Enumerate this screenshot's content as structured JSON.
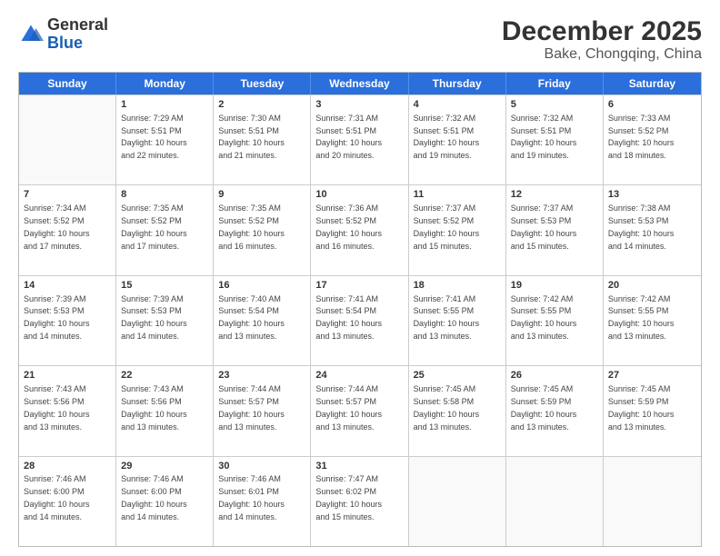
{
  "logo": {
    "general": "General",
    "blue": "Blue"
  },
  "title": "December 2025",
  "subtitle": "Bake, Chongqing, China",
  "weekdays": [
    "Sunday",
    "Monday",
    "Tuesday",
    "Wednesday",
    "Thursday",
    "Friday",
    "Saturday"
  ],
  "rows": [
    [
      {
        "day": "",
        "info": ""
      },
      {
        "day": "1",
        "info": "Sunrise: 7:29 AM\nSunset: 5:51 PM\nDaylight: 10 hours\nand 22 minutes."
      },
      {
        "day": "2",
        "info": "Sunrise: 7:30 AM\nSunset: 5:51 PM\nDaylight: 10 hours\nand 21 minutes."
      },
      {
        "day": "3",
        "info": "Sunrise: 7:31 AM\nSunset: 5:51 PM\nDaylight: 10 hours\nand 20 minutes."
      },
      {
        "day": "4",
        "info": "Sunrise: 7:32 AM\nSunset: 5:51 PM\nDaylight: 10 hours\nand 19 minutes."
      },
      {
        "day": "5",
        "info": "Sunrise: 7:32 AM\nSunset: 5:51 PM\nDaylight: 10 hours\nand 19 minutes."
      },
      {
        "day": "6",
        "info": "Sunrise: 7:33 AM\nSunset: 5:52 PM\nDaylight: 10 hours\nand 18 minutes."
      }
    ],
    [
      {
        "day": "7",
        "info": "Sunrise: 7:34 AM\nSunset: 5:52 PM\nDaylight: 10 hours\nand 17 minutes."
      },
      {
        "day": "8",
        "info": "Sunrise: 7:35 AM\nSunset: 5:52 PM\nDaylight: 10 hours\nand 17 minutes."
      },
      {
        "day": "9",
        "info": "Sunrise: 7:35 AM\nSunset: 5:52 PM\nDaylight: 10 hours\nand 16 minutes."
      },
      {
        "day": "10",
        "info": "Sunrise: 7:36 AM\nSunset: 5:52 PM\nDaylight: 10 hours\nand 16 minutes."
      },
      {
        "day": "11",
        "info": "Sunrise: 7:37 AM\nSunset: 5:52 PM\nDaylight: 10 hours\nand 15 minutes."
      },
      {
        "day": "12",
        "info": "Sunrise: 7:37 AM\nSunset: 5:53 PM\nDaylight: 10 hours\nand 15 minutes."
      },
      {
        "day": "13",
        "info": "Sunrise: 7:38 AM\nSunset: 5:53 PM\nDaylight: 10 hours\nand 14 minutes."
      }
    ],
    [
      {
        "day": "14",
        "info": "Sunrise: 7:39 AM\nSunset: 5:53 PM\nDaylight: 10 hours\nand 14 minutes."
      },
      {
        "day": "15",
        "info": "Sunrise: 7:39 AM\nSunset: 5:53 PM\nDaylight: 10 hours\nand 14 minutes."
      },
      {
        "day": "16",
        "info": "Sunrise: 7:40 AM\nSunset: 5:54 PM\nDaylight: 10 hours\nand 13 minutes."
      },
      {
        "day": "17",
        "info": "Sunrise: 7:41 AM\nSunset: 5:54 PM\nDaylight: 10 hours\nand 13 minutes."
      },
      {
        "day": "18",
        "info": "Sunrise: 7:41 AM\nSunset: 5:55 PM\nDaylight: 10 hours\nand 13 minutes."
      },
      {
        "day": "19",
        "info": "Sunrise: 7:42 AM\nSunset: 5:55 PM\nDaylight: 10 hours\nand 13 minutes."
      },
      {
        "day": "20",
        "info": "Sunrise: 7:42 AM\nSunset: 5:55 PM\nDaylight: 10 hours\nand 13 minutes."
      }
    ],
    [
      {
        "day": "21",
        "info": "Sunrise: 7:43 AM\nSunset: 5:56 PM\nDaylight: 10 hours\nand 13 minutes."
      },
      {
        "day": "22",
        "info": "Sunrise: 7:43 AM\nSunset: 5:56 PM\nDaylight: 10 hours\nand 13 minutes."
      },
      {
        "day": "23",
        "info": "Sunrise: 7:44 AM\nSunset: 5:57 PM\nDaylight: 10 hours\nand 13 minutes."
      },
      {
        "day": "24",
        "info": "Sunrise: 7:44 AM\nSunset: 5:57 PM\nDaylight: 10 hours\nand 13 minutes."
      },
      {
        "day": "25",
        "info": "Sunrise: 7:45 AM\nSunset: 5:58 PM\nDaylight: 10 hours\nand 13 minutes."
      },
      {
        "day": "26",
        "info": "Sunrise: 7:45 AM\nSunset: 5:59 PM\nDaylight: 10 hours\nand 13 minutes."
      },
      {
        "day": "27",
        "info": "Sunrise: 7:45 AM\nSunset: 5:59 PM\nDaylight: 10 hours\nand 13 minutes."
      }
    ],
    [
      {
        "day": "28",
        "info": "Sunrise: 7:46 AM\nSunset: 6:00 PM\nDaylight: 10 hours\nand 14 minutes."
      },
      {
        "day": "29",
        "info": "Sunrise: 7:46 AM\nSunset: 6:00 PM\nDaylight: 10 hours\nand 14 minutes."
      },
      {
        "day": "30",
        "info": "Sunrise: 7:46 AM\nSunset: 6:01 PM\nDaylight: 10 hours\nand 14 minutes."
      },
      {
        "day": "31",
        "info": "Sunrise: 7:47 AM\nSunset: 6:02 PM\nDaylight: 10 hours\nand 15 minutes."
      },
      {
        "day": "",
        "info": ""
      },
      {
        "day": "",
        "info": ""
      },
      {
        "day": "",
        "info": ""
      }
    ]
  ]
}
